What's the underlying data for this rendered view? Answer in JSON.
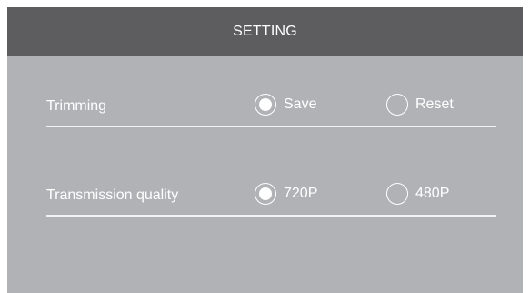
{
  "header": {
    "title": "SETTING"
  },
  "settings": [
    {
      "label": "Trimming",
      "options": [
        {
          "label": "Save",
          "selected": true
        },
        {
          "label": "Reset",
          "selected": false
        }
      ]
    },
    {
      "label": "Transmission quality",
      "options": [
        {
          "label": "720P",
          "selected": true
        },
        {
          "label": "480P",
          "selected": false
        }
      ]
    }
  ],
  "colors": {
    "header_bg": "#5d5d5f",
    "panel_bg": "#b1b2b6",
    "text": "#ffffff"
  }
}
